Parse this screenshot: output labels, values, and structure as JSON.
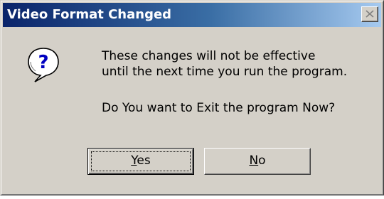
{
  "dialog": {
    "title": "Video Format Changed",
    "icon": "question-icon",
    "message_line1": "These changes will not be effective",
    "message_line2": "until the next time you run the program.",
    "message_line3": "Do You want to Exit the program Now?",
    "buttons": {
      "yes": {
        "mnemonic": "Y",
        "rest": "es",
        "focused": true
      },
      "no": {
        "mnemonic": "N",
        "rest": "o",
        "focused": false
      }
    }
  },
  "colors": {
    "titlebar_start": "#0a246a",
    "titlebar_end": "#a6caf0",
    "face": "#d4d0c8",
    "icon_glyph": "#0000c0"
  }
}
